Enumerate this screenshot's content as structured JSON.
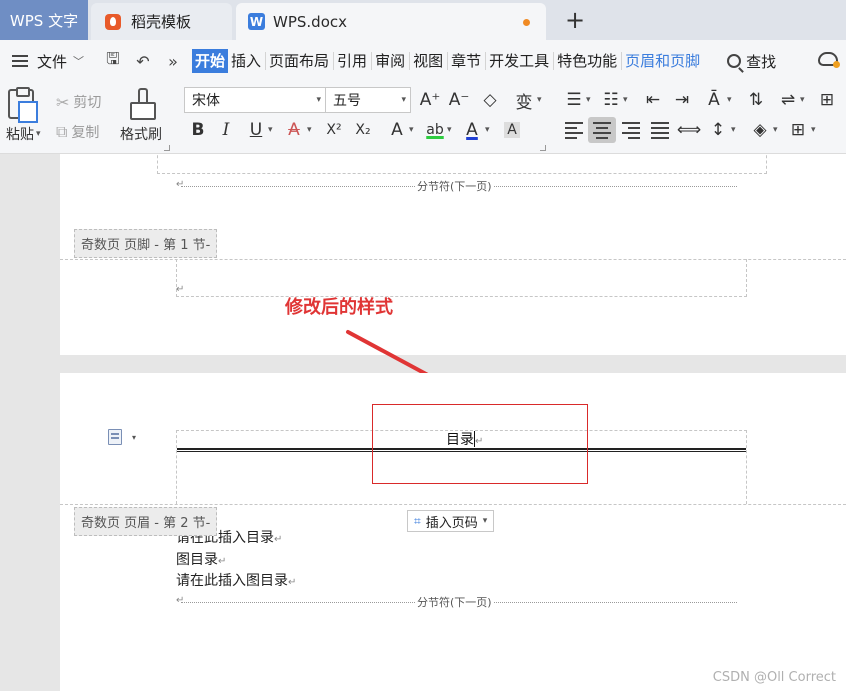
{
  "tabs": {
    "app": "WPS 文字",
    "template": "稻壳模板",
    "document": "WPS.docx",
    "new_tab": "+"
  },
  "menu": {
    "file": "文件",
    "items": [
      "开始",
      "插入",
      "页面布局",
      "引用",
      "审阅",
      "视图",
      "章节",
      "开发工具",
      "特色功能",
      "页眉和页脚"
    ],
    "active": "开始",
    "find": "查找",
    "more": "»"
  },
  "ribbon": {
    "paste": "粘贴",
    "cut": "剪切",
    "copy": "复制",
    "format_painter": "格式刷",
    "font_name": "宋体",
    "font_size": "五号",
    "bold": "B",
    "italic": "I",
    "underline": "U",
    "strike": "A",
    "superscript": "X²",
    "subscript": "X₂",
    "text_effect": "A",
    "highlight": "ab",
    "font_color": "A",
    "char_shading": "A",
    "grow_font": "A⁺",
    "shrink_font": "A⁻",
    "clear_format": "◇",
    "phonetic": "变"
  },
  "doc": {
    "section_break_label": "分节符(下一页)",
    "footer_label_1": "奇数页 页脚  - 第 1 节-",
    "annotation": "修改后的样式",
    "header_text": "目录",
    "header_label_2": "奇数页 页眉  - 第 2 节-",
    "insert_page_number": "插入页码",
    "lines": [
      "请在此插入目录",
      "图目录",
      "请在此插入图目录"
    ],
    "section_break_label_2": "分节符(下一页)",
    "return_mark": "↵",
    "watermark": "CSDN @Oll Correct"
  },
  "colors": {
    "accent": "#3b7ddd",
    "annotation_red": "#e03535",
    "app_tab": "#6f8ec4"
  }
}
